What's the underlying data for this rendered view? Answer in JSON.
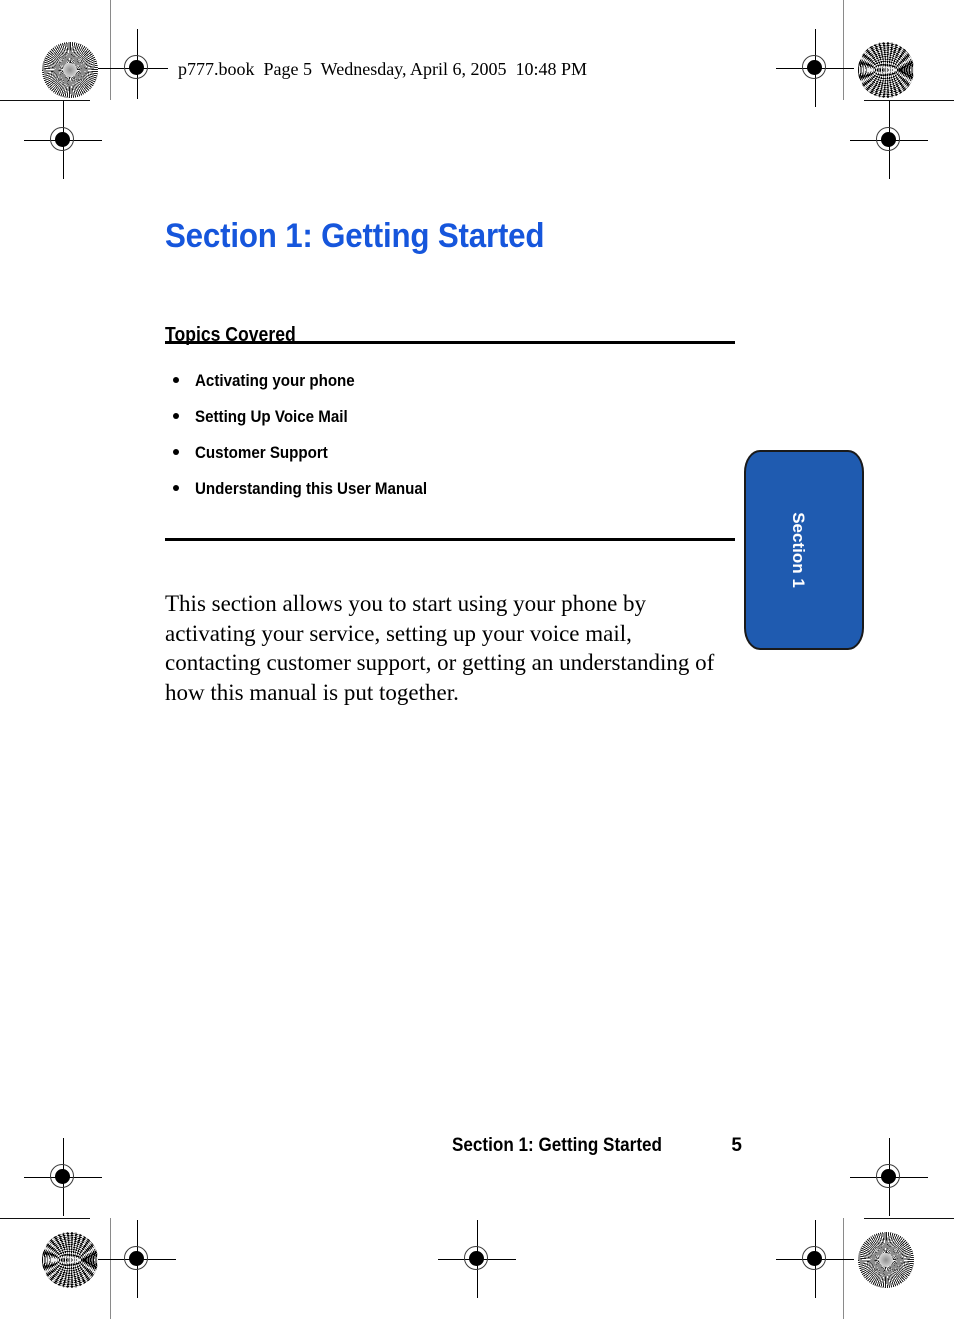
{
  "document": {
    "header_line": "p777.book  Page 5  Wednesday, April 6, 2005  10:48 PM",
    "section_title": "Section 1: Getting Started",
    "topics_heading": "Topics Covered",
    "topics": [
      "Activating your phone",
      "Setting Up Voice Mail",
      "Customer Support",
      "Understanding this User Manual"
    ],
    "body_paragraph": "This section allows you to start using your phone by activating your service, setting up your voice  mail, contacting customer support, or getting an understanding of how this manual is put together.",
    "side_tab_label": "Section 1",
    "footer": {
      "title": "Section 1: Getting Started",
      "page_number": "5"
    },
    "colors": {
      "title_blue": "#1656DC",
      "tab_blue": "#1F5BB0",
      "rule_black": "#000000",
      "trim_gray": "#8a8a8a"
    },
    "print_marks": {
      "radial_target": "radial-starburst-mark",
      "moire_target": "moire-halftone-mark",
      "registration_target": "registration-crosshair-mark"
    }
  }
}
